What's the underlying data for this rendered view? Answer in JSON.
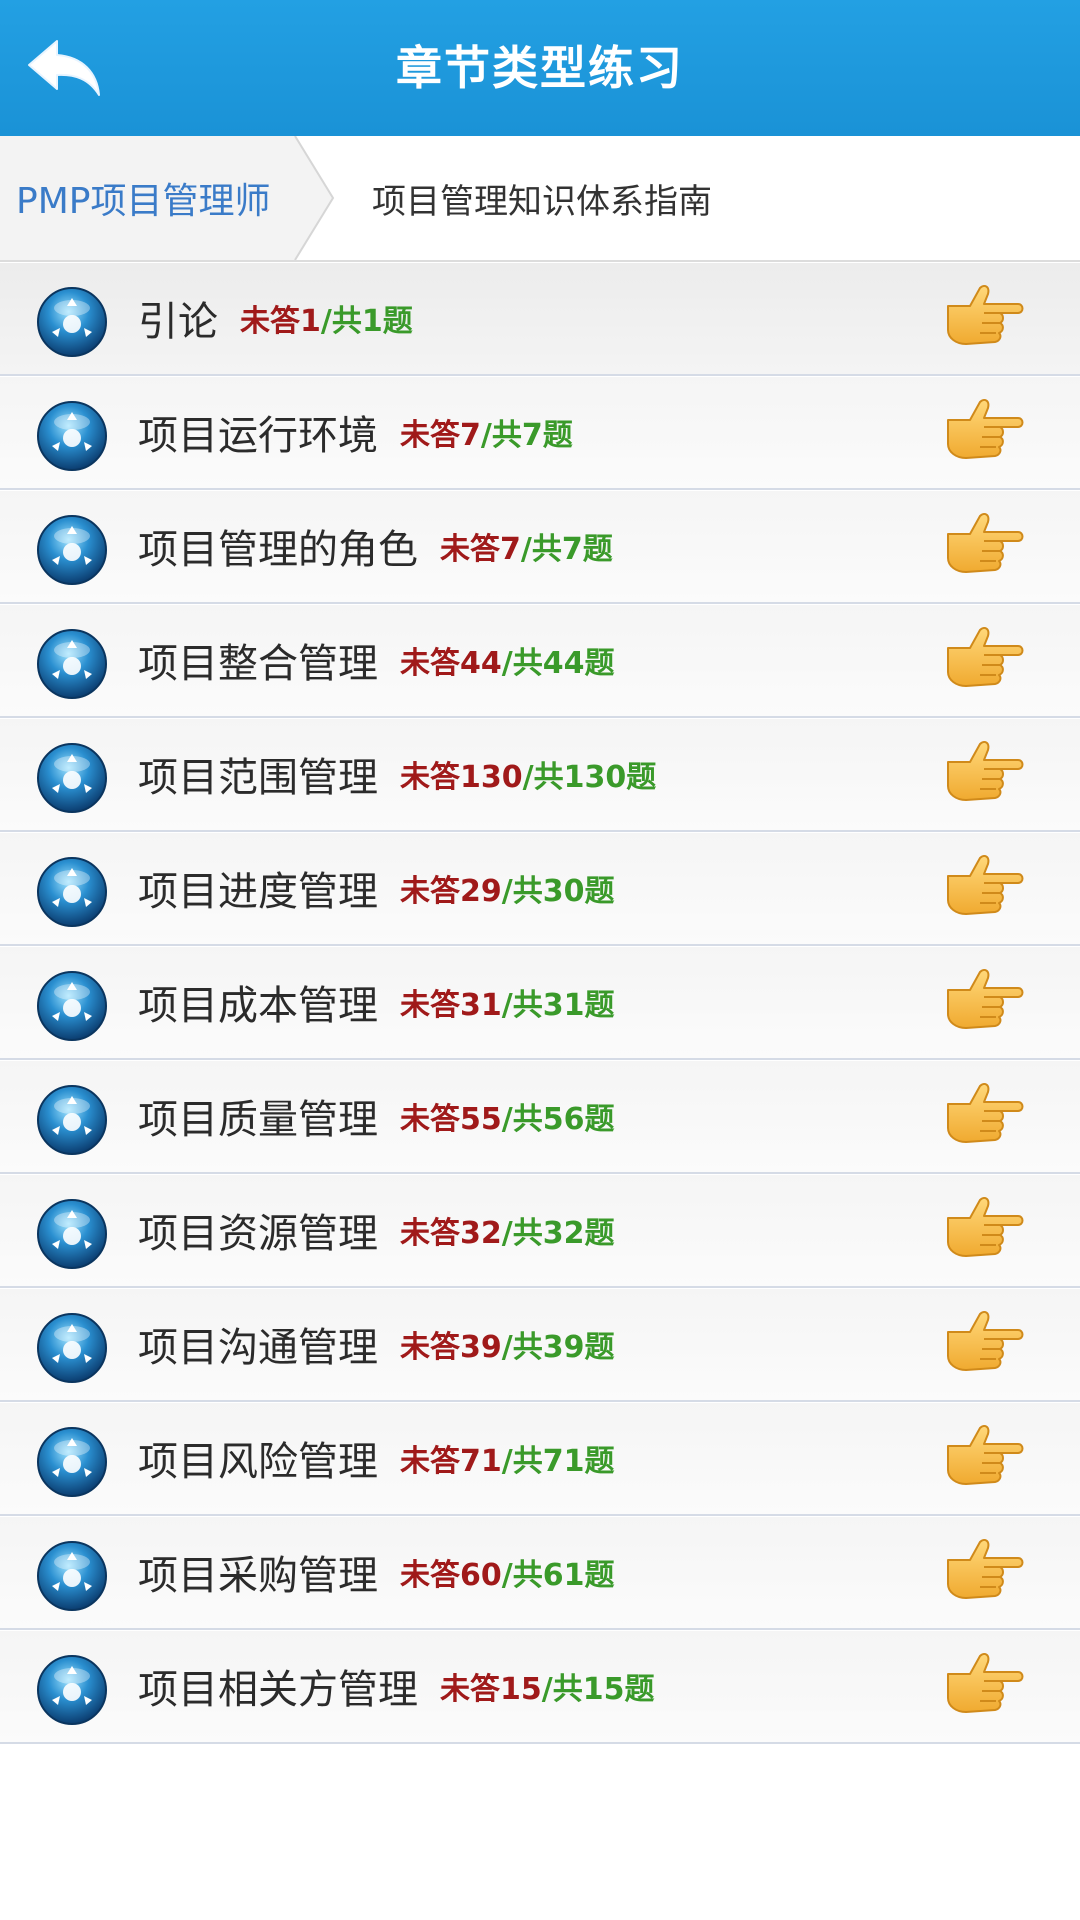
{
  "header": {
    "title": "章节类型练习"
  },
  "breadcrumb": {
    "root": "PMP项目管理师",
    "current": "项目管理知识体系指南"
  },
  "colors": {
    "header_bg": "#1a92d6",
    "unanswered": "#a01a1a",
    "total": "#3a9a2a",
    "breadcrumb_root": "#3a7bc8"
  },
  "icons": {
    "back": "back-arrow-icon",
    "row": "blue-orb-icon",
    "go": "pointing-hand-icon"
  },
  "chapters": [
    {
      "label": "引论",
      "unanswered": "未答1",
      "total": "/共1题"
    },
    {
      "label": "项目运行环境",
      "unanswered": "未答7",
      "total": "/共7题"
    },
    {
      "label": "项目管理的角色",
      "unanswered": "未答7",
      "total": "/共7题"
    },
    {
      "label": "项目整合管理",
      "unanswered": "未答44",
      "total": "/共44题"
    },
    {
      "label": "项目范围管理",
      "unanswered": "未答130",
      "total": "/共130题"
    },
    {
      "label": "项目进度管理",
      "unanswered": "未答29",
      "total": "/共30题"
    },
    {
      "label": "项目成本管理",
      "unanswered": "未答31",
      "total": "/共31题"
    },
    {
      "label": "项目质量管理",
      "unanswered": "未答55",
      "total": "/共56题"
    },
    {
      "label": "项目资源管理",
      "unanswered": "未答32",
      "total": "/共32题"
    },
    {
      "label": "项目沟通管理",
      "unanswered": "未答39",
      "total": "/共39题"
    },
    {
      "label": "项目风险管理",
      "unanswered": "未答71",
      "total": "/共71题"
    },
    {
      "label": "项目采购管理",
      "unanswered": "未答60",
      "total": "/共61题"
    },
    {
      "label": "项目相关方管理",
      "unanswered": "未答15",
      "total": "/共15题"
    }
  ]
}
